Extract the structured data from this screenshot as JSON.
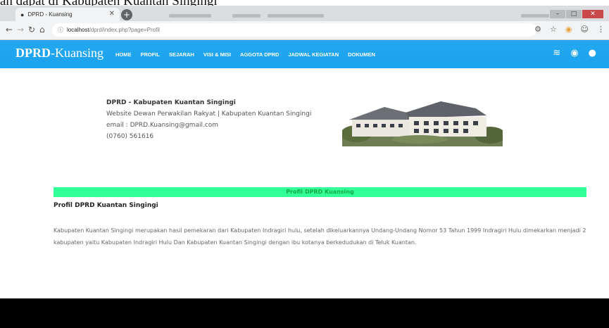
{
  "caption": "an dapat di Kabupaten Kuantan Singingi",
  "browser": {
    "tab_title": "DPRD - Kuansing",
    "url_host": "localhost",
    "url_path": "/dprd/index.php?page=Profil"
  },
  "site": {
    "brand_bold": "DPRD",
    "brand_sep": "-",
    "brand_rest": "Kuansing",
    "menu": [
      "HOME",
      "PROFIL",
      "SEJARAH",
      "VISI & MISI",
      "AGGOTA DPRD",
      "JADWAL KEGIATAN",
      "DOKUMEN"
    ]
  },
  "header_info": {
    "org": "DPRD - Kabupaten Kuantan Singingi",
    "tagline": "Website Dewan Perwakilan Rakyat | Kabupaten Kuantan Singingi",
    "email": "email : DPRD.Kuansing@gmail.com",
    "phone": "(0760) 561616"
  },
  "profile": {
    "band_title": "Profil DPRD Kuansing",
    "heading": "Profil DPRD Kuantan Singingi",
    "body": "Kabupaten Kuantan Singingi merupakan hasil pemekaran dari Kabupaten Indragiri hulu, setelah dikeluarkannya Undang-Undang Nomor 53 Tahun 1999 Indragiri Hulu dimekarkan menjadi 2 kabupaten yaitu Kabupaten Indragiri Hulu Dan Kabupaten Kuantan Singingi dengan ibu kotanya berkedudukan di Teluk Kuantan."
  },
  "colors": {
    "navbar": "#1aa3ef",
    "band": "#33ff99",
    "footer": "#000000"
  }
}
